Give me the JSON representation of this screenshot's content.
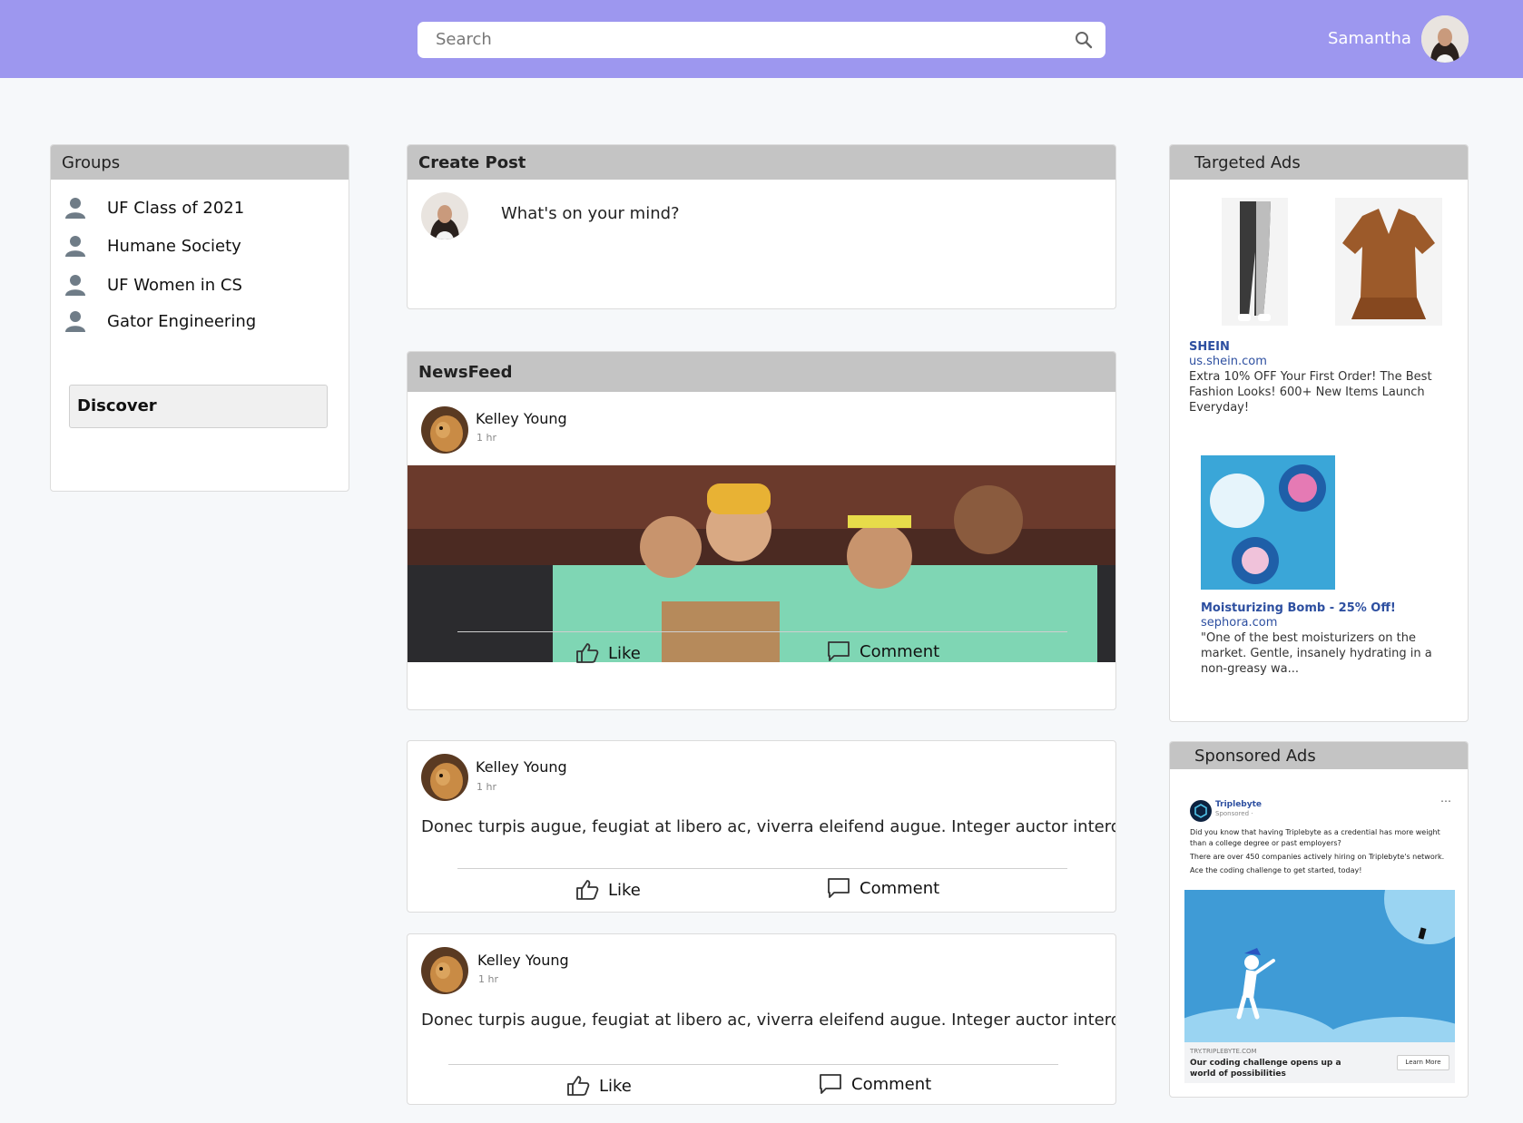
{
  "header": {
    "search_placeholder": "Search",
    "user_name": "Samantha"
  },
  "groups": {
    "title": "Groups",
    "items": [
      "UF Class of 2021",
      "Humane Society",
      "UF Women in CS",
      "Gator Engineering"
    ],
    "discover_label": "Discover"
  },
  "create_post": {
    "title": "Create Post",
    "prompt": "What's on your mind?"
  },
  "newsfeed": {
    "title": "NewsFeed",
    "posts": [
      {
        "author": "Kelley Young",
        "time": "1 hr",
        "like": "Like",
        "comment": "Comment"
      },
      {
        "author": "Kelley Young",
        "time": "1 hr",
        "body": "Donec turpis augue, feugiat at libero ac, viverra eleifend augue. Integer auctor interdum",
        "like": "Like",
        "comment": "Comment"
      },
      {
        "author": "Kelley Young",
        "time": "1 hr",
        "body": "Donec turpis augue, feugiat at libero ac, viverra eleifend augue. Integer auctor interdum",
        "like": "Like",
        "comment": "Comment"
      }
    ]
  },
  "targeted_ads": {
    "title": "Targeted Ads",
    "ads": [
      {
        "brand": "SHEIN",
        "domain": "us.shein.com",
        "desc": "Extra 10% OFF Your First Order! The Best Fashion Looks! 600+ New Items Launch Everyday!"
      },
      {
        "brand": "Moisturizing Bomb - 25% Off!",
        "domain": "sephora.com",
        "desc": "\"One of the best moisturizers on the market. Gentle, insanely hydrating in a non-greasy wa..."
      }
    ]
  },
  "sponsored_ads": {
    "title": "Sponsored Ads",
    "advertiser": "Triplebyte",
    "sponsored_label": "Sponsored · ",
    "text_1": "Did you know that having Triplebyte as a credential has more weight than a college degree or past employers?",
    "text_2": "There are over 450 companies actively hiring on Triplebyte's network.",
    "text_3": "Ace the coding challenge to get started, today!",
    "url": "TRY.TRIPLEBYTE.COM",
    "headline": "Our coding challenge opens up a world of possibilities",
    "cta": "Learn More"
  },
  "colors": {
    "header_bg": "#9d97ef",
    "card_header_bg": "#c4c4c4",
    "link_blue": "#2d4fa0"
  }
}
